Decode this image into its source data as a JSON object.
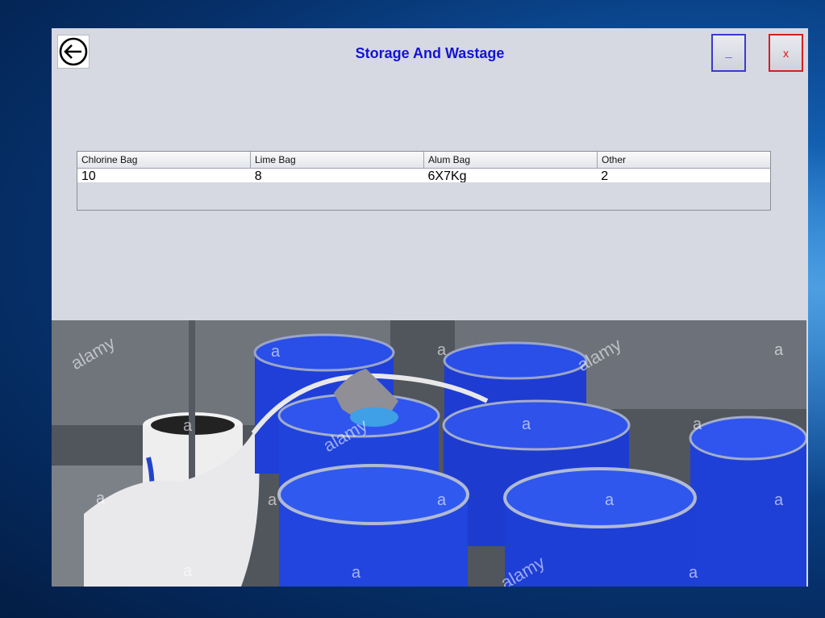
{
  "window": {
    "title": "Storage And Wastage",
    "minimize_label": "_",
    "close_label": "x"
  },
  "icons": {
    "back": "arrow-left-circle-icon"
  },
  "table": {
    "columns": [
      "Chlorine Bag",
      "Lime Bag",
      "Alum Bag",
      "Other"
    ],
    "rows": [
      [
        "10",
        "8",
        "6X7Kg",
        "2"
      ]
    ]
  },
  "photo": {
    "watermark": "alamy",
    "watermark_mark": "a"
  },
  "colors": {
    "title": "#1414d2",
    "minimize_border": "#3a3ad0",
    "close": "#e01010",
    "window_bg": "#d6d9e2",
    "barrel_blue": "#1f3fd8"
  }
}
